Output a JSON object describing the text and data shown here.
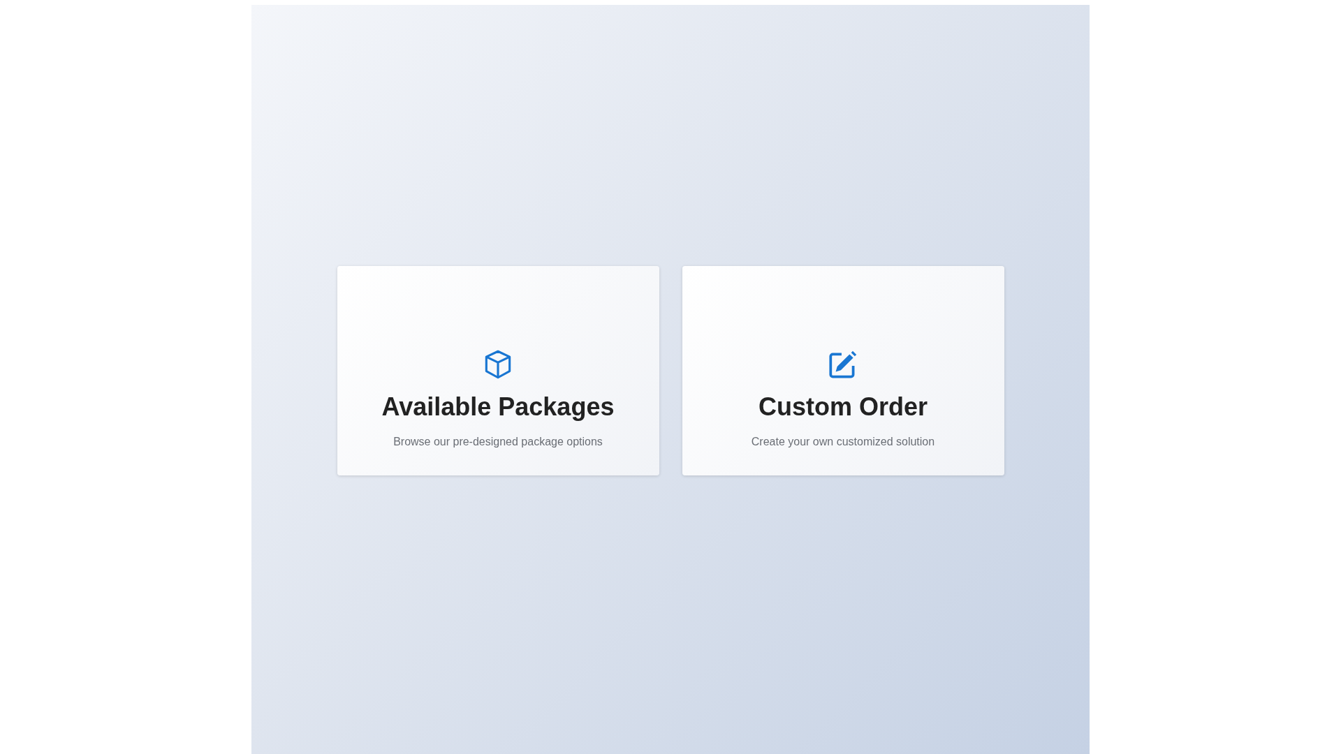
{
  "options": [
    {
      "kind": "package",
      "title": "Available Packages",
      "description": "Browse our pre-designed package options"
    },
    {
      "kind": "edit",
      "title": "Custom Order",
      "description": "Create your own customized solution"
    }
  ]
}
